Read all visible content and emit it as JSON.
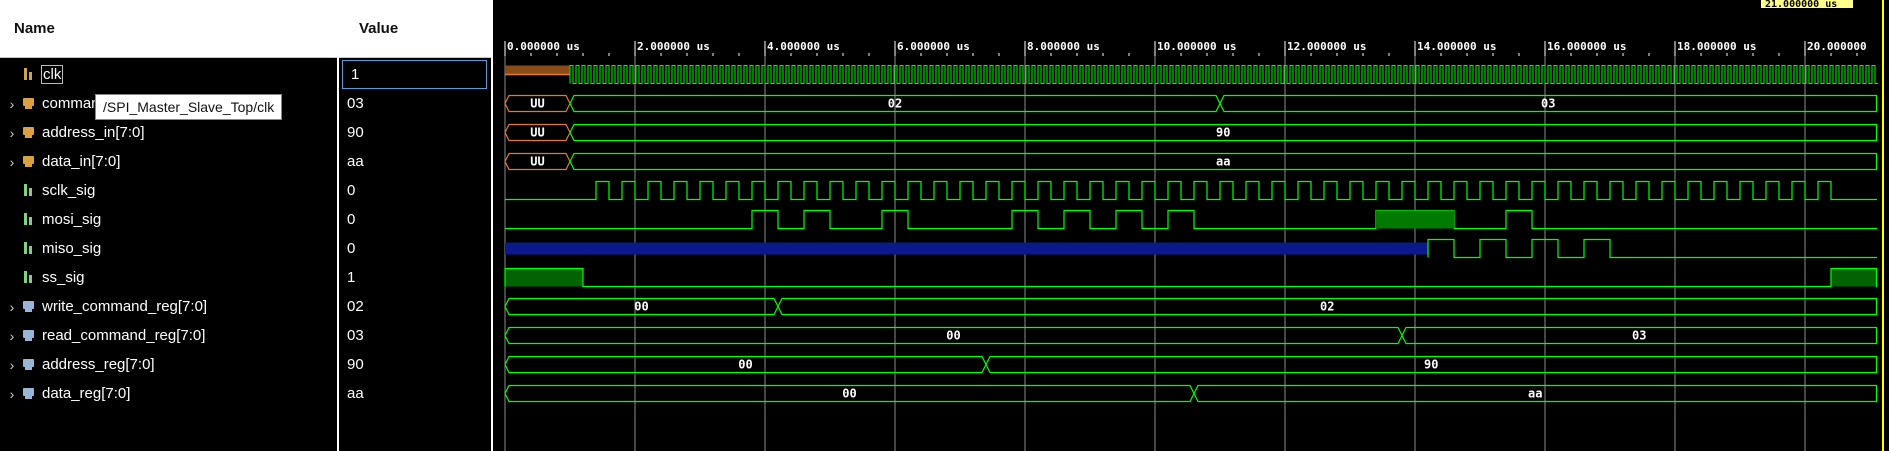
{
  "columns": {
    "name": "Name",
    "value": "Value"
  },
  "tooltip": "/SPI_Master_Slave_Top/clk",
  "cursor_time": "21.000000 us",
  "signals": [
    {
      "name": "clk",
      "value": "1",
      "expandable": false,
      "kind": "bit"
    },
    {
      "name": "command_in[7:0]",
      "value": "03",
      "expandable": true,
      "kind": "bus"
    },
    {
      "name": "address_in[7:0]",
      "value": "90",
      "expandable": true,
      "kind": "bus"
    },
    {
      "name": "data_in[7:0]",
      "value": "aa",
      "expandable": true,
      "kind": "bus"
    },
    {
      "name": "sclk_sig",
      "value": "0",
      "expandable": false,
      "kind": "bitg"
    },
    {
      "name": "mosi_sig",
      "value": "0",
      "expandable": false,
      "kind": "bitg"
    },
    {
      "name": "miso_sig",
      "value": "0",
      "expandable": false,
      "kind": "bitg"
    },
    {
      "name": "ss_sig",
      "value": "1",
      "expandable": false,
      "kind": "bitg"
    },
    {
      "name": "write_command_reg[7:0]",
      "value": "02",
      "expandable": true,
      "kind": "busg"
    },
    {
      "name": "read_command_reg[7:0]",
      "value": "03",
      "expandable": true,
      "kind": "busg"
    },
    {
      "name": "address_reg[7:0]",
      "value": "90",
      "expandable": true,
      "kind": "busg"
    },
    {
      "name": "data_reg[7:0]",
      "value": "aa",
      "expandable": true,
      "kind": "busg"
    }
  ],
  "time_ticks": [
    "0.000000 us",
    "2.000000 us",
    "4.000000 us",
    "6.000000 us",
    "8.000000 us",
    "10.000000 us",
    "12.000000 us",
    "14.000000 us",
    "16.000000 us",
    "18.000000 us",
    "20.000000"
  ],
  "waves": {
    "command_in": [
      {
        "from": 0,
        "to": 1,
        "label": "UU",
        "undefined": true
      },
      {
        "from": 1,
        "to": 11,
        "label": "02"
      },
      {
        "from": 11,
        "to": 21.1,
        "label": "03"
      }
    ],
    "address_in": [
      {
        "from": 0,
        "to": 1,
        "label": "UU",
        "undefined": true
      },
      {
        "from": 1,
        "to": 21.1,
        "label": "90"
      }
    ],
    "data_in": [
      {
        "from": 0,
        "to": 1,
        "label": "UU",
        "undefined": true
      },
      {
        "from": 1,
        "to": 21.1,
        "label": "aa"
      }
    ],
    "write_command_reg": [
      {
        "from": 0,
        "to": 4.2,
        "label": "00"
      },
      {
        "from": 4.2,
        "to": 21.1,
        "label": "02"
      }
    ],
    "read_command_reg": [
      {
        "from": 0,
        "to": 13.8,
        "label": "00"
      },
      {
        "from": 13.8,
        "to": 21.1,
        "label": "03"
      }
    ],
    "address_reg": [
      {
        "from": 0,
        "to": 7.4,
        "label": "00"
      },
      {
        "from": 7.4,
        "to": 21.1,
        "label": "90"
      }
    ],
    "data_reg": [
      {
        "from": 0,
        "to": 10.6,
        "label": "00"
      },
      {
        "from": 10.6,
        "to": 21.1,
        "label": "aa"
      }
    ],
    "sclk_high": [
      [
        1.4,
        1.6
      ],
      [
        1.8,
        2.0
      ],
      [
        2.2,
        2.4
      ],
      [
        2.6,
        2.8
      ],
      [
        3.0,
        3.2
      ],
      [
        3.4,
        3.6
      ],
      [
        3.8,
        4.0
      ],
      [
        4.2,
        4.4
      ],
      [
        4.6,
        4.8
      ],
      [
        5.0,
        5.2
      ],
      [
        5.4,
        5.6
      ],
      [
        5.8,
        6.0
      ],
      [
        6.2,
        6.4
      ],
      [
        6.6,
        6.8
      ],
      [
        7.0,
        7.2
      ],
      [
        7.4,
        7.6
      ],
      [
        7.8,
        8.0
      ],
      [
        8.2,
        8.4
      ],
      [
        8.6,
        8.8
      ],
      [
        9.0,
        9.2
      ],
      [
        9.4,
        9.6
      ],
      [
        9.8,
        10.0
      ],
      [
        10.2,
        10.4
      ],
      [
        10.6,
        10.8
      ],
      [
        11.0,
        11.2
      ],
      [
        11.4,
        11.6
      ],
      [
        11.8,
        12.0
      ],
      [
        12.2,
        12.4
      ],
      [
        12.6,
        12.8
      ],
      [
        13.0,
        13.2
      ],
      [
        13.4,
        13.6
      ],
      [
        13.8,
        14.0
      ],
      [
        14.2,
        14.4
      ],
      [
        14.6,
        14.8
      ],
      [
        15.0,
        15.2
      ],
      [
        15.4,
        15.6
      ],
      [
        15.8,
        16.0
      ],
      [
        16.2,
        16.4
      ],
      [
        16.6,
        16.8
      ],
      [
        17.0,
        17.2
      ],
      [
        17.4,
        17.6
      ],
      [
        17.8,
        18.0
      ],
      [
        18.2,
        18.4
      ],
      [
        18.6,
        18.8
      ],
      [
        19.0,
        19.2
      ],
      [
        19.4,
        19.6
      ],
      [
        19.8,
        20.0
      ],
      [
        20.2,
        20.4
      ]
    ],
    "mosi_high": [
      [
        3.8,
        4.2
      ],
      [
        4.6,
        5.0
      ],
      [
        5.8,
        6.2
      ],
      [
        7.8,
        8.2
      ],
      [
        8.6,
        9.0
      ],
      [
        9.4,
        9.8
      ],
      [
        10.2,
        10.6
      ],
      [
        13.4,
        14.6
      ],
      [
        15.4,
        15.8
      ]
    ],
    "miso_undefined": [
      0,
      14.2
    ],
    "miso_high": [
      [
        14.2,
        14.6
      ],
      [
        15.0,
        15.4
      ],
      [
        15.8,
        16.2
      ],
      [
        16.6,
        17.0
      ]
    ],
    "ss_high": [
      [
        0,
        1.2
      ],
      [
        20.4,
        21.1
      ]
    ],
    "clk_undefined": [
      0,
      1
    ]
  }
}
